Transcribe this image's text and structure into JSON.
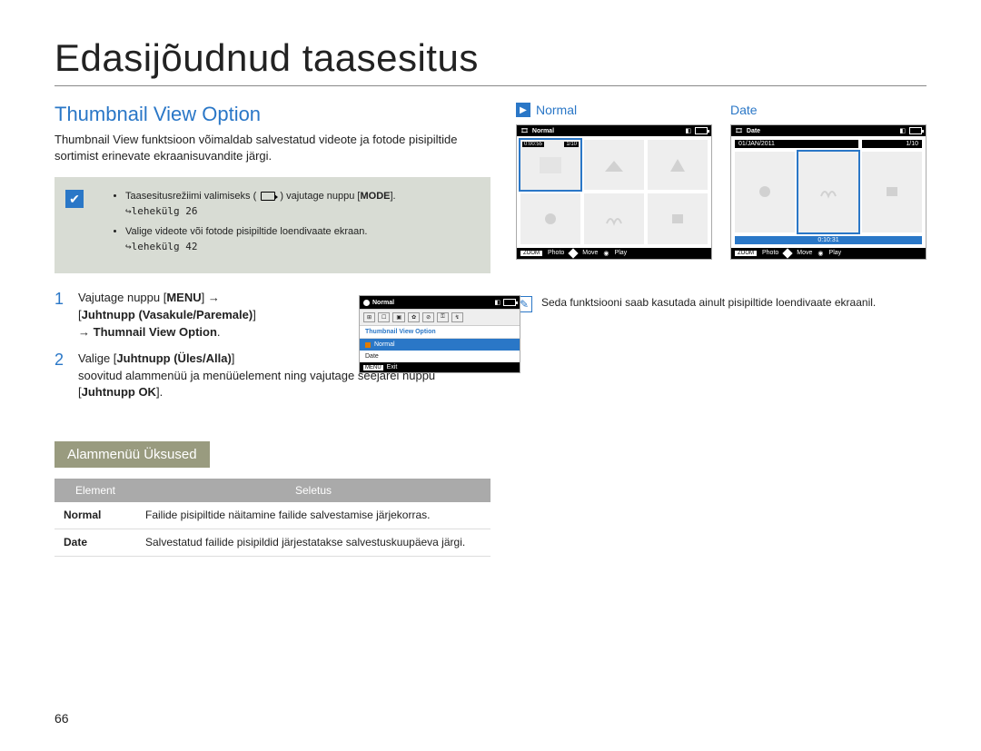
{
  "page_title": "Edasijõudnud taasesitus",
  "page_number": "66",
  "section_title": "Thumbnail View Option",
  "intro": "Thumbnail View funktsioon võimaldab salvestatud videote ja fotode pisipiltide sortimist erinevate ekraanisuvandite järgi.",
  "note": {
    "items": [
      {
        "pre": "Taasesitusrežiimi valimiseks (",
        "post": ") vajutage nuppu [",
        "bold": "MODE",
        "tail": "].",
        "link": "↪lehekülg 26"
      },
      {
        "text": "Valige videote või fotode pisipiltide loendivaate ekraan.",
        "link": "↪lehekülg 42"
      }
    ]
  },
  "steps": [
    {
      "num": "1",
      "p1a": "Vajutage nuppu [",
      "p1b": "MENU",
      "p1c": "] →",
      "p2a": "[",
      "p2b": "Juhtnupp (Vasakule/Paremale)",
      "p2c": "]",
      "p3a": "→ ",
      "p3b": "Thumnail View Option",
      "p3c": "."
    },
    {
      "num": "2",
      "p1a": "Valige [",
      "p1b": "Juhtnupp (Üles/Alla)",
      "p1c": "]",
      "rest": "soovitud alammenüü ja menüüelement ning vajutage seejärel nuppu [",
      "restb": "Juhtnupp OK",
      "restc": "]."
    }
  ],
  "menu_screenshot": {
    "top_label": "Normal",
    "header": "Thumbnail View Option",
    "items": [
      "Normal",
      "Date"
    ],
    "exit_tag": "MENU",
    "exit_label": "Exit"
  },
  "subsection_title": "Alammenüü Üksused",
  "table": {
    "headers": [
      "Element",
      "Seletus"
    ],
    "rows": [
      {
        "name": "Normal",
        "desc": "Failide pisipiltide näitamine failide salvestamise järjekorras."
      },
      {
        "name": "Date",
        "desc": "Salvestatud failide pisipildid järjestatakse salvestuskuupäeva järgi."
      }
    ]
  },
  "screens": {
    "normal": {
      "label": "Normal",
      "top_label": "Normal",
      "thumb1_time": "0:00:55",
      "thumb1_count": "1/10",
      "footer": {
        "zoom": "ZOOM",
        "photo": "Photo",
        "move": "Move",
        "play": "Play"
      }
    },
    "date": {
      "label": "Date",
      "top_label": "Date",
      "date_label": "01/JAN/2011",
      "count": "1/10",
      "bottom_time": "0:10:31",
      "footer": {
        "zoom": "ZOOM",
        "photo": "Photo",
        "move": "Move",
        "play": "Play"
      }
    }
  },
  "footnote": "Seda funktsiooni saab kasutada ainult pisipiltide loendivaate ekraanil."
}
